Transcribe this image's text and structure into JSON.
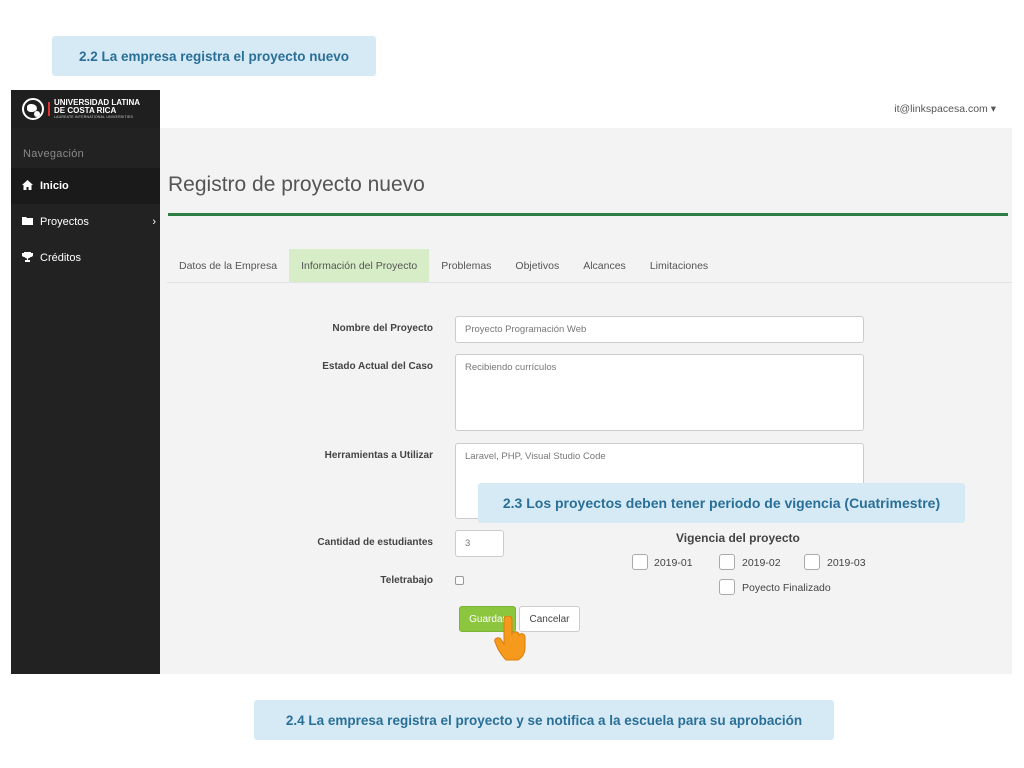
{
  "callouts": {
    "step_2_2": "2.2 La empresa registra el proyecto nuevo",
    "step_2_3": "2.3 Los proyectos deben tener periodo de vigencia (Cuatrimestre)",
    "step_2_4": "2.4 La empresa registra el proyecto y se notifica a la escuela para su aprobación"
  },
  "brand": {
    "line1": "UNIVERSIDAD LATINA",
    "line2": "DE COSTA RICA",
    "line3": "LAUREATE INTERNATIONAL UNIVERSITIES"
  },
  "user": {
    "email": "it@linkspacesa.com",
    "caret": "▾"
  },
  "sidebar": {
    "header": "Navegación",
    "items": [
      {
        "label": "Inicio",
        "icon": "home-icon",
        "glyph": "🏠",
        "active": true
      },
      {
        "label": "Proyectos",
        "icon": "folder-icon",
        "glyph": "▆",
        "caret": "›"
      },
      {
        "label": "Créditos",
        "icon": "trophy-icon",
        "glyph": "🏆"
      }
    ]
  },
  "page": {
    "title": "Registro de proyecto nuevo"
  },
  "tabs": [
    {
      "label": "Datos de la Empresa"
    },
    {
      "label": "Información del Proyecto",
      "active": true
    },
    {
      "label": "Problemas"
    },
    {
      "label": "Objetivos"
    },
    {
      "label": "Alcances"
    },
    {
      "label": "Limitaciones"
    }
  ],
  "form": {
    "nombre": {
      "label": "Nombre del Proyecto",
      "value": "Proyecto Programación Web"
    },
    "estado": {
      "label": "Estado Actual del Caso",
      "value": "Recibiendo currículos"
    },
    "herramientas": {
      "label": "Herramientas a Utilizar",
      "value": "Laravel, PHP, Visual Studio Code"
    },
    "cantidad": {
      "label": "Cantidad de estudiantes",
      "value": "3"
    },
    "teletrabajo": {
      "label": "Teletrabajo",
      "checked": false
    }
  },
  "vigencia": {
    "title": "Vigencia del proyecto",
    "options": [
      {
        "label": "2019-01",
        "checked": false
      },
      {
        "label": "2019-02",
        "checked": false
      },
      {
        "label": "2019-03",
        "checked": false
      },
      {
        "label": "Poyecto Finalizado",
        "checked": false
      }
    ]
  },
  "buttons": {
    "save": "Guardar",
    "cancel": "Cancelar"
  },
  "colors": {
    "accent_green": "#2e7d45",
    "save_button": "#8cc63f",
    "active_tab": "#d6edc7",
    "callout_bg": "#d6eaf5",
    "callout_text": "#2a6f97"
  }
}
